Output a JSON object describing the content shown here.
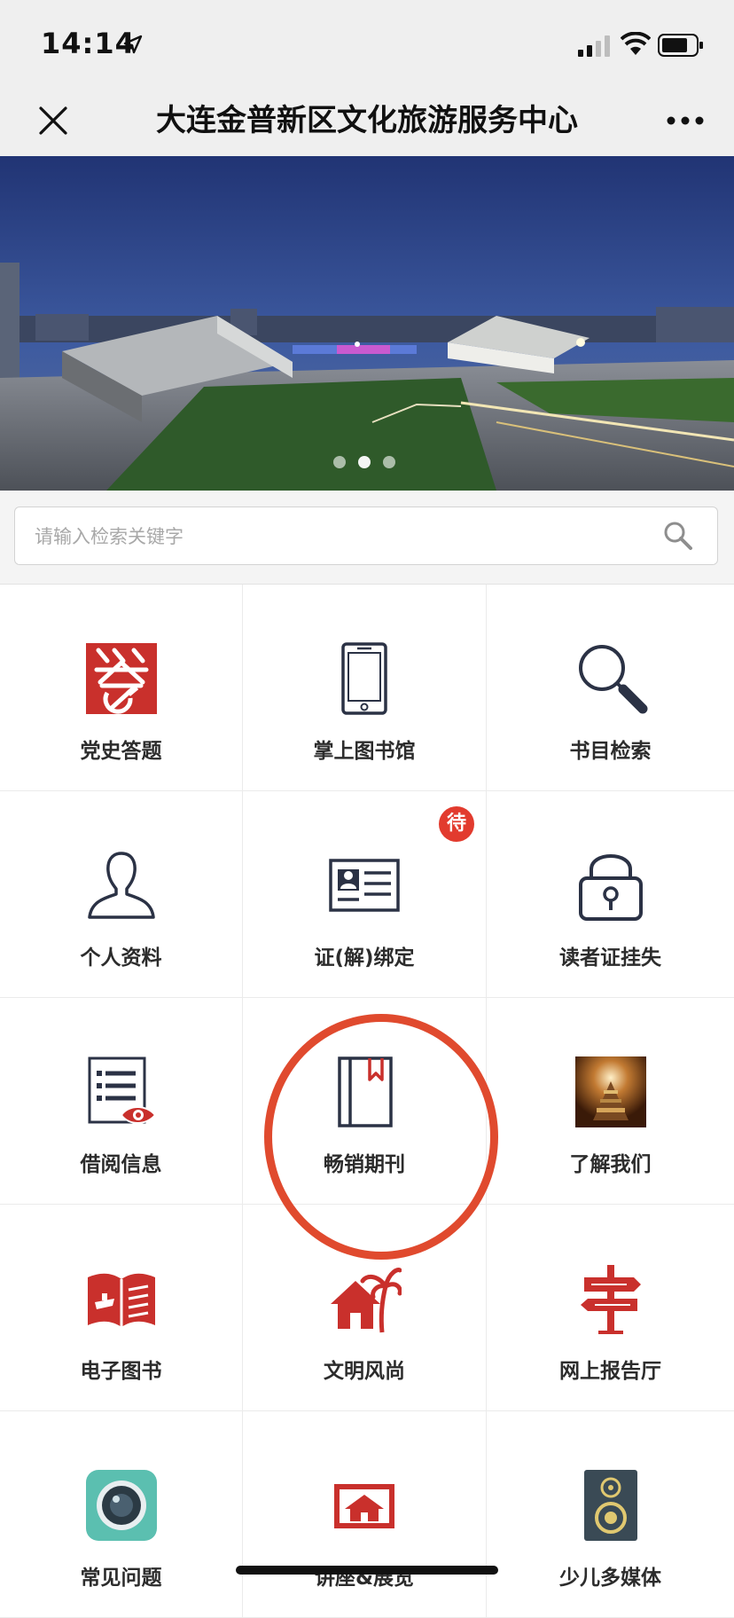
{
  "status_bar": {
    "time": "14:14"
  },
  "nav": {
    "title": "大连金普新区文化旅游服务中心"
  },
  "banner": {
    "slide_count": 3,
    "active_slide": 2
  },
  "search": {
    "placeholder": "请输入检索关键字",
    "value": ""
  },
  "grid": [
    [
      {
        "label": "党史答题",
        "icon": "party-history-quiz-icon",
        "color": "#c9302c"
      },
      {
        "label": "掌上图书馆",
        "icon": "mobile-phone-icon",
        "color": "#2b3245"
      },
      {
        "label": "书目检索",
        "icon": "magnifier-icon",
        "color": "#2b3245"
      }
    ],
    [
      {
        "label": "个人资料",
        "icon": "user-profile-icon",
        "color": "#2b3245"
      },
      {
        "label": "证(解)绑定",
        "icon": "id-card-icon",
        "color": "#2b3245",
        "badge": "待"
      },
      {
        "label": "读者证挂失",
        "icon": "padlock-icon",
        "color": "#2b3245"
      }
    ],
    [
      {
        "label": "借阅信息",
        "icon": "borrow-list-eye-icon",
        "color": "#2b3245"
      },
      {
        "label": "畅销期刊",
        "icon": "bookmarked-book-icon",
        "color": "#2b3245"
      },
      {
        "label": "了解我们",
        "icon": "about-us-photo-icon",
        "color": "#6b3a1a"
      }
    ],
    [
      {
        "label": "电子图书",
        "icon": "open-ebook-icon",
        "color": "#c9302c"
      },
      {
        "label": "文明风尚",
        "icon": "house-palm-icon",
        "color": "#c9302c"
      },
      {
        "label": "网上报告厅",
        "icon": "signpost-icon",
        "color": "#c9302c"
      }
    ],
    [
      {
        "label": "常见问题",
        "icon": "camera-lens-icon",
        "color": "#5bbfb0"
      },
      {
        "label": "讲座&展览",
        "icon": "framed-house-picture-icon",
        "color": "#c9302c"
      },
      {
        "label": "少儿多媒体",
        "icon": "speaker-icon",
        "color": "#3a4a55"
      }
    ]
  ],
  "highlighted_item": "畅销期刊",
  "colors": {
    "accent_red": "#c9302c",
    "ring": "#e04a2e",
    "icon_dark": "#2b3245"
  }
}
